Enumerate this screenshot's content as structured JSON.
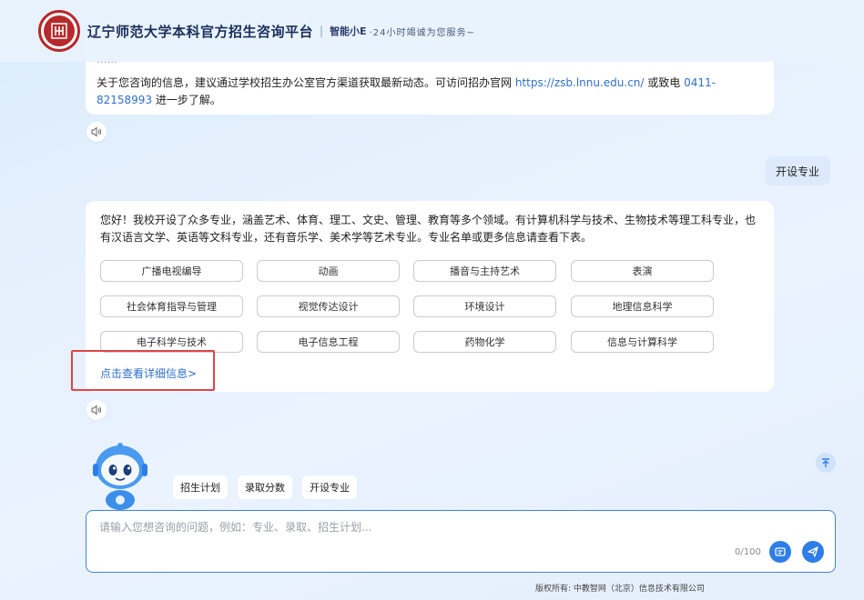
{
  "header": {
    "title": "辽宁师范大学本科官方招生咨询平台",
    "separator": "|",
    "brand": "智能小E",
    "tagline": "·24小时竭诚为您服务~"
  },
  "previous_answer": {
    "cut_line": "......",
    "text_before": "关于您咨询的信息，建议通过学校招生办公室官方渠道获取最新动态。可访问招办官网 ",
    "site": "https://zsb.lnnu.edu.cn/",
    "text_middle": " 或致电 ",
    "phone": "0411-82158993",
    "text_after": " 进一步了解。"
  },
  "user_message": "开设专业",
  "answer": {
    "text": "您好！我校开设了众多专业，涵盖艺术、体育、理工、文史、管理、教育等多个领域。有计算机科学与技术、生物技术等理工科专业，也有汉语言文学、英语等文科专业，还有音乐学、美术学等艺术专业。专业名单或更多信息请查看下表。",
    "majors": [
      "广播电视编导",
      "动画",
      "播音与主持艺术",
      "表演",
      "社会体育指导与管理",
      "视觉传达设计",
      "环境设计",
      "地理信息科学",
      "电子科学与技术",
      "电子信息工程",
      "药物化学",
      "信息与计算科学"
    ],
    "detail_link": "点击查看详细信息>"
  },
  "quick_chips": [
    "招生计划",
    "录取分数",
    "开设专业"
  ],
  "input": {
    "placeholder": "请输入您想咨询的问题，例如：专业、录取、招生计划...",
    "value": "",
    "counter": "0/100"
  },
  "footer": "版权所有: 中教智网（北京）信息技术有限公司",
  "colors": {
    "accent": "#2f7de8",
    "link": "#2f6fd0",
    "highlight": "#e04545",
    "logo_red": "#b8292b"
  },
  "icons": [
    "logo-seal-icon",
    "speaker-icon",
    "robot-mascot-icon",
    "arrow-up-icon",
    "note-icon",
    "send-icon"
  ]
}
